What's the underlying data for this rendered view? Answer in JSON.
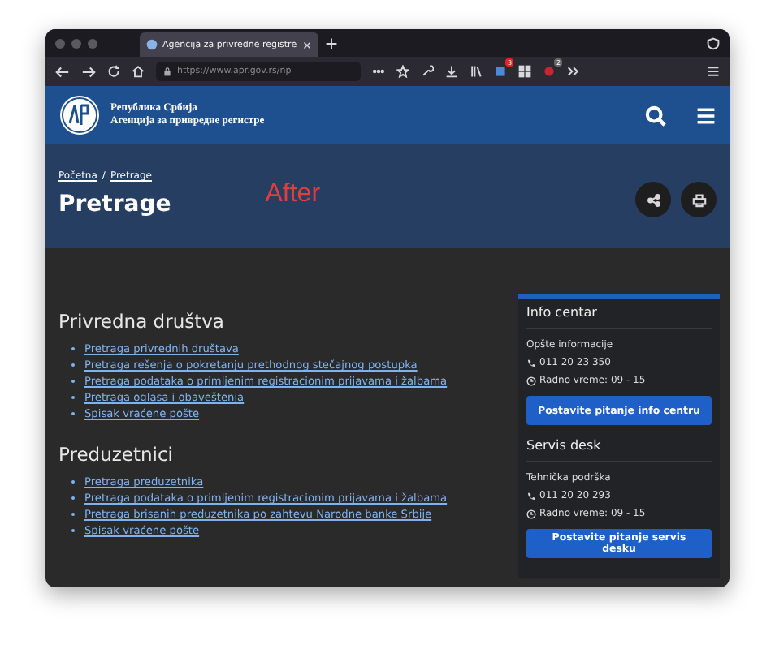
{
  "browser": {
    "tab_title": "Agencija za privredne registre",
    "url": "https://www.apr.gov.rs/np",
    "badges": [
      "3",
      "2"
    ]
  },
  "header": {
    "org_line_1": "Република Србија",
    "org_line_2": "Агенција за привредне регистре"
  },
  "hero": {
    "breadcrumb": [
      {
        "label": "Početna"
      },
      {
        "label": "Pretrage"
      }
    ],
    "breadcrumb_separator": "/",
    "title": "Pretrage",
    "annotation": "After"
  },
  "sections": [
    {
      "title": "Privredna društva",
      "links": [
        "Pretraga privrednih društava",
        "Pretraga rešenja o pokretanju prethodnog stečajnog postupka",
        "Pretraga podataka o primljenim registracionim prijavama i žalbama",
        "Pretraga oglasa i obaveštenja",
        "Spisak vraćene pošte"
      ]
    },
    {
      "title": "Preduzetnici",
      "links": [
        "Pretraga preduzetnika",
        "Pretraga podataka o primljenim registracionim prijavama i žalbama",
        "Pretraga brisanih preduzetnika po zahtevu Narodne banke Srbije",
        "Spisak vraćene pošte"
      ]
    }
  ],
  "sidebar": [
    {
      "title": "Info centar",
      "subtitle": "Opšte informacije",
      "phone": "011 20 23 350",
      "hours": "Radno vreme: 09 - 15",
      "button": "Postavite pitanje info centru"
    },
    {
      "title": "Servis desk",
      "subtitle": "Tehnička podrška",
      "phone": "011 20 20 293",
      "hours": "Radno vreme: 09 - 15",
      "button": "Postavite pitanje servis desku"
    }
  ]
}
